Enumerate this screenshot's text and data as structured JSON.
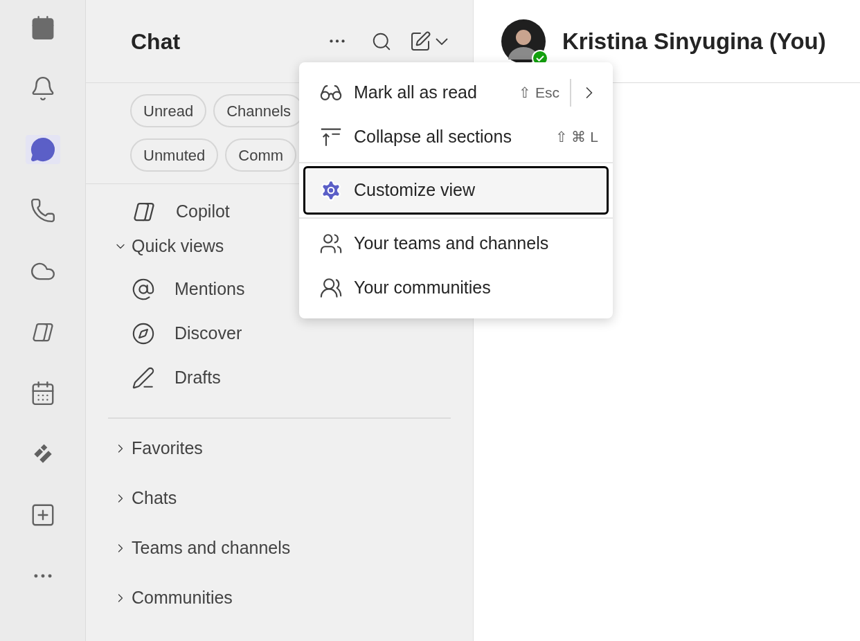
{
  "rail": [
    {
      "kind": "calendar",
      "selected": false
    },
    {
      "kind": "activity",
      "selected": false
    },
    {
      "kind": "chat",
      "selected": true
    },
    {
      "kind": "calls",
      "selected": false
    },
    {
      "kind": "onedrive",
      "selected": false
    },
    {
      "kind": "copilot",
      "selected": false
    },
    {
      "kind": "calendar-grid",
      "selected": false
    },
    {
      "kind": "planner",
      "selected": false
    },
    {
      "kind": "apps",
      "selected": false
    },
    {
      "kind": "more",
      "selected": false
    }
  ],
  "panel": {
    "title": "Chat",
    "filters": [
      [
        "Unread",
        "Channels"
      ],
      [
        "Unmuted",
        "Comm"
      ]
    ],
    "items": [
      {
        "kind": "copilot",
        "label": "Copilot"
      },
      {
        "kind": "section",
        "label": "Quick views",
        "expanded": true,
        "children": [
          {
            "kind": "mention",
            "label": "Mentions"
          },
          {
            "kind": "discover",
            "label": "Discover"
          },
          {
            "kind": "drafts",
            "label": "Drafts"
          }
        ]
      }
    ],
    "sections": [
      {
        "label": "Favorites",
        "expanded": false
      },
      {
        "label": "Chats",
        "expanded": false
      },
      {
        "label": "Teams and channels",
        "expanded": false
      },
      {
        "label": "Communities",
        "expanded": false
      }
    ]
  },
  "chat_header": {
    "name": "Kristina Sinyugina (You)"
  },
  "menu": {
    "groups": [
      [
        {
          "kind": "read",
          "label": "Mark all as read",
          "shortcut": "⇧ Esc",
          "submenu": true,
          "focused": false
        },
        {
          "kind": "collapse",
          "label": "Collapse all sections",
          "shortcut": "⇧ ⌘ L",
          "submenu": false,
          "focused": false
        }
      ],
      [
        {
          "kind": "customize",
          "label": "Customize view",
          "submenu": false,
          "focused": true
        }
      ],
      [
        {
          "kind": "teams",
          "label": "Your teams and channels",
          "submenu": false,
          "focused": false
        },
        {
          "kind": "communities",
          "label": "Your communities",
          "submenu": false,
          "focused": false
        }
      ]
    ]
  }
}
